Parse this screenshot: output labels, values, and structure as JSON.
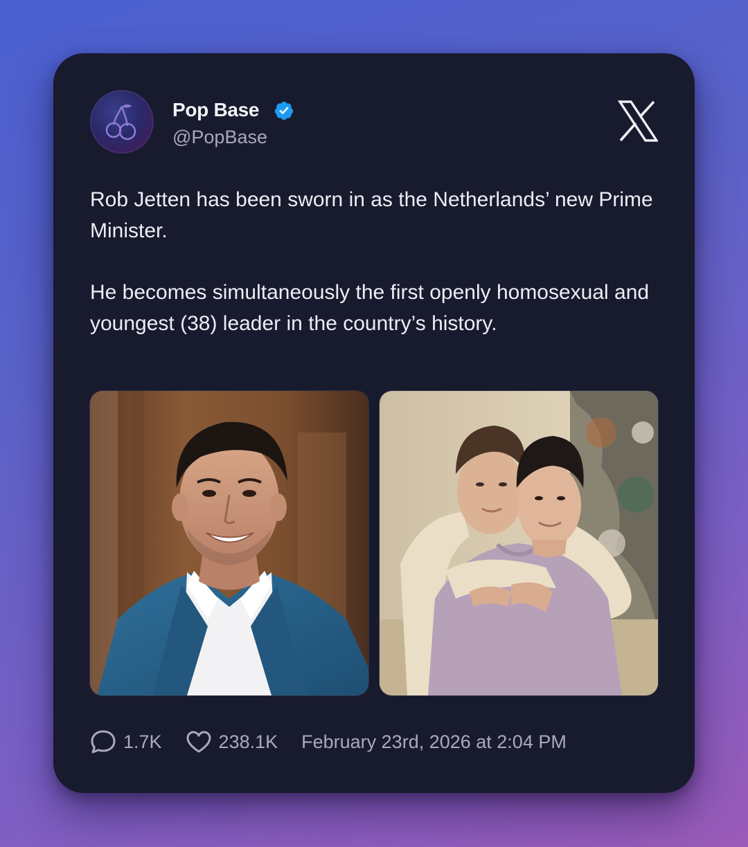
{
  "post": {
    "author_name": "Pop Base",
    "author_handle": "@PopBase",
    "verified": true,
    "platform_icon": "x-logo-icon",
    "text_paragraphs": [
      "Rob Jetten has been sworn in as the Netherlands’ new Prime Minister.",
      "He becomes simultaneously the first openly homosexual and youngest (38) leader in the country’s history."
    ],
    "images": [
      {
        "icon": "photo-portrait"
      },
      {
        "icon": "photo-couple"
      }
    ],
    "stats": {
      "replies": "1.7K",
      "likes": "238.1K",
      "timestamp": "February 23rd, 2026 at 2:04 PM"
    }
  },
  "colors": {
    "card_background": "#181a2e",
    "verified_badge": "#1d9bf0",
    "primary_text": "#eceef5",
    "secondary_text": "#a9abbd"
  }
}
